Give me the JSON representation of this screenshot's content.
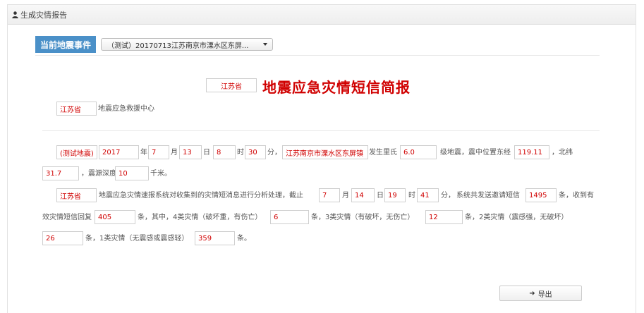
{
  "panel": {
    "title": "生成灾情报告"
  },
  "event": {
    "label": "当前地震事件",
    "selected": "（测试）20170713江苏南京市溧水区东屏..."
  },
  "report": {
    "province_box": "江苏省",
    "title": "地震应急灾情短信简报",
    "center_province": "江苏省",
    "center_suffix": "地震应急救援中心",
    "p1": {
      "tag": "(测试地震)",
      "year": "2017",
      "year_unit": "年",
      "month": "7",
      "month_unit": "月",
      "day": "13",
      "day_unit": "日",
      "hour": "8",
      "hour_unit": "时",
      "minute": "30",
      "minute_unit": "分，",
      "location": "江苏南京市溧水区东屏镇",
      "after_location": "发生里氏",
      "magnitude": "6.0",
      "after_magnitude": "级地震，震中位置东经",
      "longitude": "119.11",
      "after_longitude": "，北纬",
      "latitude": "31.7",
      "after_latitude": "，震源深度",
      "depth": "10",
      "depth_unit": "千米。"
    },
    "p2": {
      "province": "江苏省",
      "text1": "地震应急灾情速报系统对收集到的灾情短消息进行分析处理，截止",
      "month": "7",
      "month_unit": "月",
      "day": "14",
      "day_unit": "日",
      "hour": "19",
      "hour_unit": "时",
      "minute": "41",
      "minute_unit": "分，",
      "text2": "系统共发送邀请短信",
      "sent": "1495",
      "text3": "条，收到有",
      "text4": "效灾情短信回复",
      "replies": "405",
      "text5": "条，其中，4类灾情（破坏重，有伤亡）",
      "c4": "6",
      "text6": "条，3类灾情（有破坏，无伤亡）",
      "c3": "12",
      "text7": "条，2类灾情（震感强，无破坏）",
      "c2": "26",
      "text8": "条，1类灾情（无震感或震感轻）",
      "c1": "359",
      "text9": "条。"
    }
  },
  "actions": {
    "export_label": "导出"
  }
}
